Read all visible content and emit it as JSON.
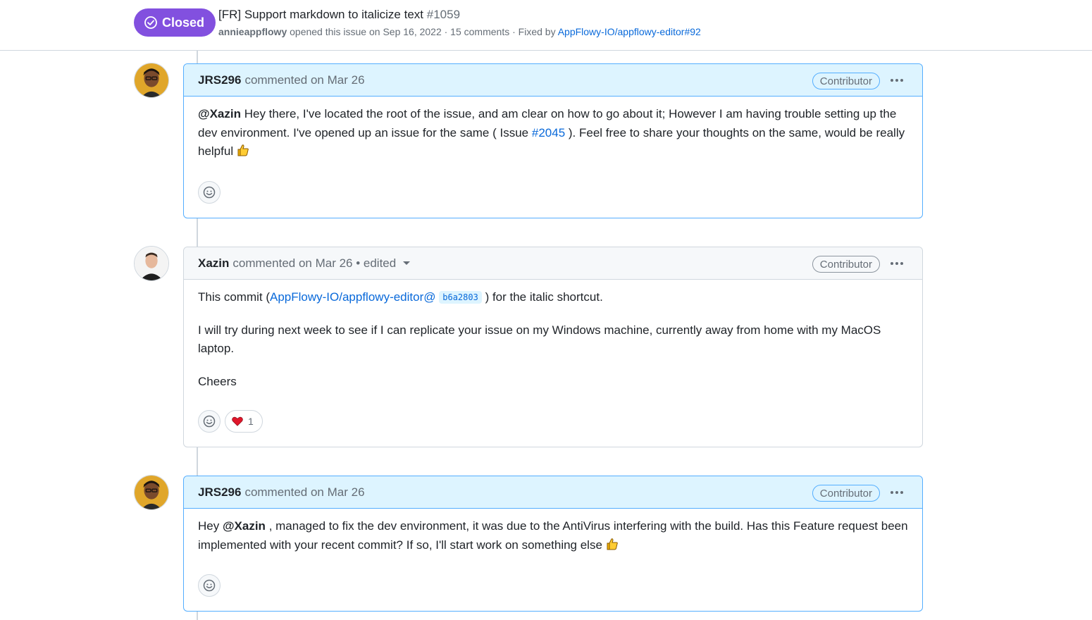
{
  "issue": {
    "state": "Closed",
    "title": "[FR] Support markdown to italicize text",
    "number": "#1059",
    "author": "annieappflowy",
    "opened_text": "opened this issue on Sep 16, 2022 · 15 comments · Fixed by",
    "fixed_by": "AppFlowy-IO/appflowy-editor#92",
    "state_color": "#8250df"
  },
  "comments": [
    {
      "author": "JRS296",
      "meta": "commented on Mar 26",
      "role": "Contributor",
      "mention": "@Xazin",
      "text_a": "Hey there, I've located the root of the issue, and am clear on how to go about it; However I am having trouble setting up the dev environment. I've opened up an issue for the same ( Issue",
      "issue_link": "#2045",
      "text_b": "). Feel free to share your thoughts on the same, would be really helpful",
      "emoji": "thumbs-up-icon"
    },
    {
      "author": "Xazin",
      "meta": "commented on Mar 26 • edited",
      "role": "Contributor",
      "p1_a": "This commit (",
      "p1_link": "AppFlowy-IO/appflowy-editor@",
      "p1_sha": "b6a2803",
      "p1_b": ") for the italic shortcut.",
      "p2": "I will try during next week to see if I can replicate your issue on my Windows machine, currently away from home with my MacOS laptop.",
      "p3": "Cheers",
      "reaction_count": "1",
      "reaction_icon": "heart-icon"
    },
    {
      "author": "JRS296",
      "meta": "commented on Mar 26",
      "role": "Contributor",
      "text_a": "Hey",
      "mention": "@Xazin",
      "text_b": ", managed to fix the dev environment, it was due to the AntiVirus interfering with the build. Has this Feature request been implemented with your recent commit? If so, I'll start work on something else",
      "emoji": "thumbs-up-icon"
    }
  ]
}
